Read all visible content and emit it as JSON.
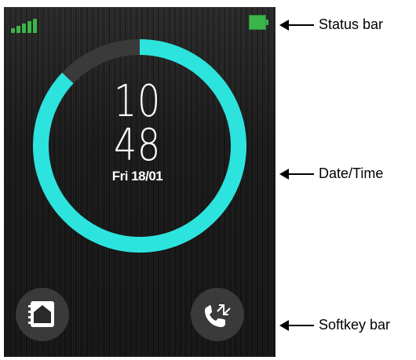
{
  "screen": {
    "time": {
      "hour": "10",
      "minute": "48"
    },
    "date": "Fri 18/01",
    "progress_fraction": 0.87,
    "colors": {
      "ring": "#2de3de",
      "ring_track": "#3a3a3a",
      "status_green": "#3bb54a"
    },
    "status_bar": {
      "signal_icon": "signal-strength-icon",
      "battery_icon": "battery-full-icon"
    },
    "softkeys": {
      "left": {
        "icon": "home-contacts-icon"
      },
      "right": {
        "icon": "call-transfer-icon"
      }
    }
  },
  "annotations": [
    {
      "label": "Status bar"
    },
    {
      "label": "Date/Time"
    },
    {
      "label": "Softkey bar"
    }
  ]
}
